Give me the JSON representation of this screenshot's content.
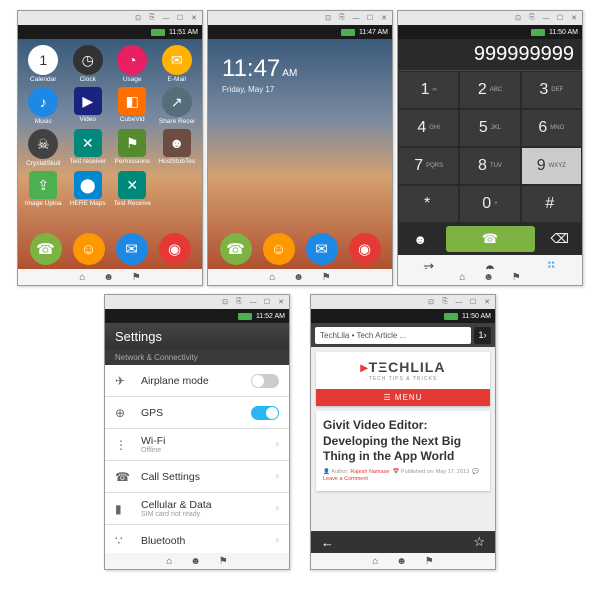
{
  "window_controls": {
    "min": "—",
    "max": "☐",
    "close": "✕",
    "extra1": "⊡",
    "extra2": "⎘"
  },
  "phone1": {
    "time": "11:51 AM",
    "apps": [
      {
        "label": "Calendar",
        "glyph": "1",
        "bg": "#ffffff",
        "fg": "#333",
        "shape": "circ"
      },
      {
        "label": "Clock",
        "glyph": "◷",
        "bg": "#333333",
        "shape": "circ"
      },
      {
        "label": "Usage",
        "glyph": "◔",
        "bg": "#e91e63",
        "shape": "circ"
      },
      {
        "label": "E-Mail",
        "glyph": "✉",
        "bg": "#ffb300",
        "shape": "circ"
      },
      {
        "label": "Music",
        "glyph": "♪",
        "bg": "#1e88e5",
        "shape": "circ"
      },
      {
        "label": "Video",
        "glyph": "▶",
        "bg": "#1a237e",
        "shape": "sq"
      },
      {
        "label": "CubeVid",
        "glyph": "◧",
        "bg": "#ff6f00",
        "shape": "sq"
      },
      {
        "label": "Share Recei",
        "glyph": "↗",
        "bg": "#546e7a",
        "shape": "circ"
      },
      {
        "label": "CrystalSkull",
        "glyph": "☠",
        "bg": "#424242",
        "shape": "circ"
      },
      {
        "label": "Test receiver",
        "glyph": "✕",
        "bg": "#00897b",
        "shape": "sq"
      },
      {
        "label": "Permissions",
        "glyph": "⚑",
        "bg": "#558b2f",
        "shape": "sq"
      },
      {
        "label": "HostStubTes",
        "glyph": "☻",
        "bg": "#6d4c41",
        "shape": "sq"
      },
      {
        "label": "Image Uploa",
        "glyph": "⇪",
        "bg": "#4caf50",
        "shape": "sq"
      },
      {
        "label": "HERE Maps",
        "glyph": "⬤",
        "bg": "#0288d1",
        "shape": "sq"
      },
      {
        "label": "Test Receive",
        "glyph": "✕",
        "bg": "#00897b",
        "shape": "sq"
      }
    ],
    "dock": [
      {
        "glyph": "☎",
        "bg": "#7cb342"
      },
      {
        "glyph": "☺",
        "bg": "#ff9800"
      },
      {
        "glyph": "✉",
        "bg": "#1e88e5"
      },
      {
        "glyph": "◉",
        "bg": "#e53935"
      }
    ]
  },
  "phone2": {
    "time_status": "11:47 AM",
    "clock_time": "11:47",
    "clock_ampm": "AM",
    "clock_date": "Friday, May 17"
  },
  "phone3": {
    "time": "11:50 AM",
    "number": "999999999",
    "keys": [
      {
        "n": "1",
        "l": "∞"
      },
      {
        "n": "2",
        "l": "ABC"
      },
      {
        "n": "3",
        "l": "DEF"
      },
      {
        "n": "4",
        "l": "GHI"
      },
      {
        "n": "5",
        "l": "JKL"
      },
      {
        "n": "6",
        "l": "MNO"
      },
      {
        "n": "7",
        "l": "PQRS"
      },
      {
        "n": "8",
        "l": "TUV"
      },
      {
        "n": "9",
        "l": "WXYZ"
      },
      {
        "n": "*",
        "l": ""
      },
      {
        "n": "0",
        "l": "+"
      },
      {
        "n": "#",
        "l": ""
      }
    ]
  },
  "phone4": {
    "time": "11:52 AM",
    "title": "Settings",
    "section": "Network & Connectivity",
    "rows": [
      {
        "icon": "✈",
        "label": "Airplane mode",
        "toggle": "off"
      },
      {
        "icon": "⊕",
        "label": "GPS",
        "toggle": "on"
      },
      {
        "icon": "⋮",
        "label": "Wi-Fi",
        "sub": "Offline"
      },
      {
        "icon": "☎",
        "label": "Call Settings"
      },
      {
        "icon": "▮",
        "label": "Cellular & Data",
        "sub": "SIM card not ready"
      },
      {
        "icon": "∵",
        "label": "Bluetooth"
      }
    ]
  },
  "phone5": {
    "time": "11:50 AM",
    "url_title": "TechLila • Tech Article ...",
    "tab_count": "1›",
    "logo_main": "TΞCHLILA",
    "logo_sub": "TECH TIPS & TRICKS",
    "menu_label": "MENU",
    "post_title": "Givit Video Editor: Developing the Next Big Thing in the App World",
    "meta_author_lbl": "Author:",
    "meta_author": "Rajesh Namase",
    "meta_pub_lbl": "Published on:",
    "meta_pub": "May 17, 2013",
    "meta_comment": "Leave a Comment"
  },
  "navbar": {
    "home": "⌂",
    "person": "☻",
    "pin": "⚑"
  }
}
